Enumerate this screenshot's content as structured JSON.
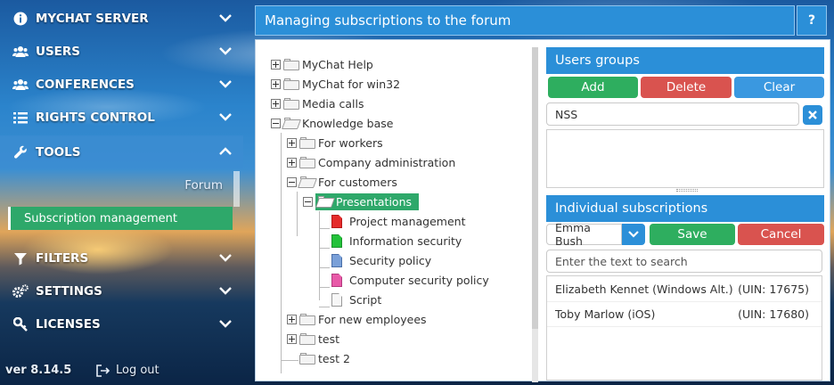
{
  "sidebar": {
    "items": [
      {
        "label": "MYCHAT SERVER",
        "icon": "info-icon"
      },
      {
        "label": "USERS",
        "icon": "users-icon"
      },
      {
        "label": "CONFERENCES",
        "icon": "users-icon"
      },
      {
        "label": "RIGHTS CONTROL",
        "icon": "list-icon"
      },
      {
        "label": "TOOLS",
        "icon": "wrench-icon"
      },
      {
        "label": "FILTERS",
        "icon": "filter-icon"
      },
      {
        "label": "SETTINGS",
        "icon": "gears-icon"
      },
      {
        "label": "LICENSES",
        "icon": "key-icon"
      }
    ],
    "tools_sub": {
      "forum": "Forum",
      "active": "Subscription management"
    },
    "version": "ver 8.14.5",
    "logout": "Log out"
  },
  "header": {
    "title": "Managing subscriptions to the forum",
    "help": "?"
  },
  "tree": [
    {
      "label": "MyChat Help"
    },
    {
      "label": "MyChat for win32"
    },
    {
      "label": "Media calls"
    },
    {
      "label": "Knowledge base"
    },
    {
      "label": "For workers"
    },
    {
      "label": "Company administration"
    },
    {
      "label": "For customers"
    },
    {
      "label": "Presentations"
    },
    {
      "label": "Project management"
    },
    {
      "label": "Information security"
    },
    {
      "label": "Security policy"
    },
    {
      "label": "Computer security policy"
    },
    {
      "label": "Script"
    },
    {
      "label": "For new employees"
    },
    {
      "label": "test"
    },
    {
      "label": "test 2"
    }
  ],
  "users_groups": {
    "title": "Users groups",
    "add": "Add",
    "delete": "Delete",
    "clear": "Clear",
    "filter_value": "NSS"
  },
  "individual": {
    "title": "Individual subscriptions",
    "selected_user": "Emma Bush",
    "save": "Save",
    "cancel": "Cancel",
    "search_placeholder": "Enter the text to search",
    "rows": [
      {
        "name": "Elizabeth Kennet (Windows Alt.)",
        "uin": "(UIN: 17675)"
      },
      {
        "name": "Toby Marlow (iOS)",
        "uin": "(UIN: 17680)"
      }
    ]
  },
  "colors": {
    "accent": "#2b8fd8",
    "green": "#2eae5f",
    "red": "#d9534f"
  }
}
